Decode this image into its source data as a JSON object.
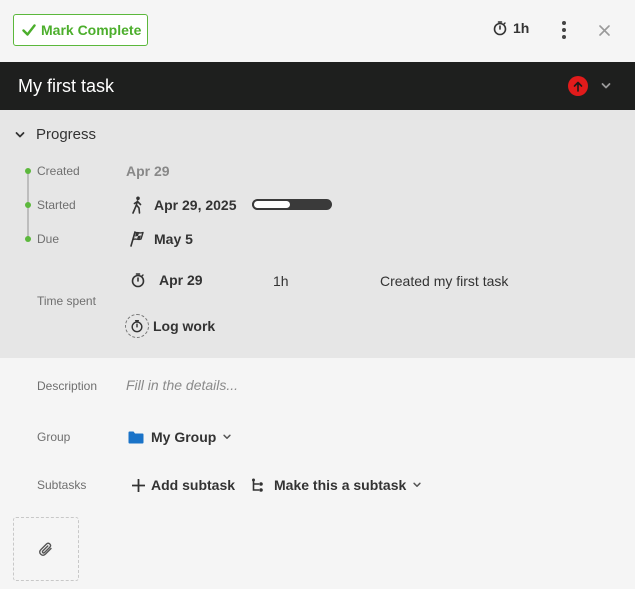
{
  "toolbar": {
    "mark_complete_label": "Mark Complete",
    "timer_value": "1h",
    "icons": {
      "check": "check-icon",
      "timer": "stopwatch-icon",
      "more": "kebab-icon",
      "close": "close-icon"
    }
  },
  "task": {
    "title": "My first task",
    "priority_color": "#e11b1b"
  },
  "progress": {
    "heading": "Progress",
    "created_label": "Created",
    "created_value": "Apr 29",
    "started_label": "Started",
    "started_value": "Apr 29, 2025",
    "started_progress": 0.5,
    "due_label": "Due",
    "due_value": "May 5",
    "time_spent_label": "Time spent",
    "time_entries": [
      {
        "date": "Apr 29",
        "duration": "1h",
        "note": "Created my first task"
      }
    ],
    "log_work_label": "Log work"
  },
  "fields": {
    "description_label": "Description",
    "description_placeholder": "Fill in the details...",
    "group_label": "Group",
    "group_value": "My Group",
    "subtasks_label": "Subtasks",
    "add_subtask_label": "Add subtask",
    "make_subtask_label": "Make this a subtask"
  },
  "colors": {
    "accent_green": "#5cb83c",
    "title_bar": "#1e1f1e",
    "folder_blue": "#1a73c8"
  }
}
